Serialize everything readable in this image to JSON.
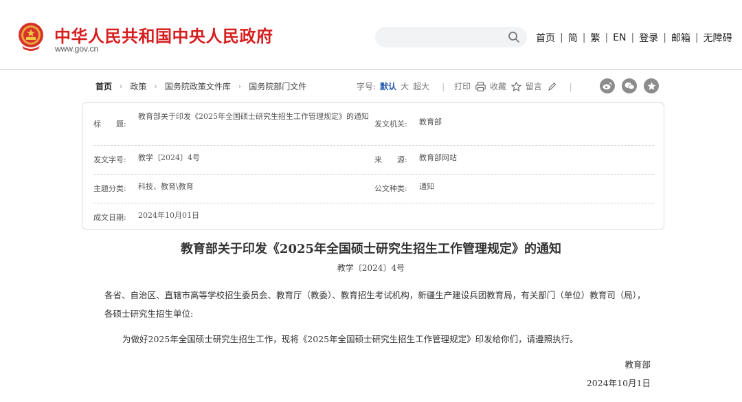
{
  "header": {
    "site_name": "中华人民共和国中央人民政府",
    "site_domain": "www.gov.cn",
    "search": {
      "placeholder": ""
    },
    "nav": [
      "首页",
      "简",
      "繁",
      "EN",
      "登录",
      "邮箱",
      "无障碍"
    ],
    "brand_color": "#d61f1f"
  },
  "breadcrumb": {
    "items": [
      "首页",
      "政策",
      "国务院政策文件库",
      "国务院部门文件"
    ]
  },
  "tools": {
    "font_size_label": "字号:",
    "font_default": "默认",
    "font_large": "大",
    "font_xlarge": "超大",
    "print": "打印",
    "favorite": "收藏",
    "message": "留言",
    "share_icons": [
      "weibo-icon",
      "wechat-icon",
      "star-share-icon"
    ]
  },
  "meta": {
    "title_label": "标　　题:",
    "title_value": "教育部关于印发《2025年全国硕士研究生招生工作管理规定》的通知",
    "issuer_label": "发文机关:",
    "issuer_value": "教育部",
    "docno_label": "发文字号:",
    "docno_value": "教学〔2024〕4号",
    "source_label": "来　　源:",
    "source_value": "教育部网站",
    "topic_label": "主题分类:",
    "topic_value": "科技、教育\\教育",
    "doctype_label": "公文种类:",
    "doctype_value": "通知",
    "date_label": "成文日期:",
    "date_value": "2024年10月01日"
  },
  "article": {
    "title": "教育部关于印发《2025年全国硕士研究生招生工作管理规定》的通知",
    "docno": "教学〔2024〕4号",
    "para1": "各省、自治区、直辖市高等学校招生委员会、教育厅（教委）、教育招生考试机构，新疆生产建设兵团教育局，有关部门（单位）教育司（局），各硕士研究生招生单位:",
    "para2": "为做好2025年全国硕士研究生招生工作，现将《2025年全国硕士研究生招生工作管理规定》印发给你们，请遵照执行。",
    "sign_org": "教育部",
    "sign_date": "2024年10月1日"
  }
}
